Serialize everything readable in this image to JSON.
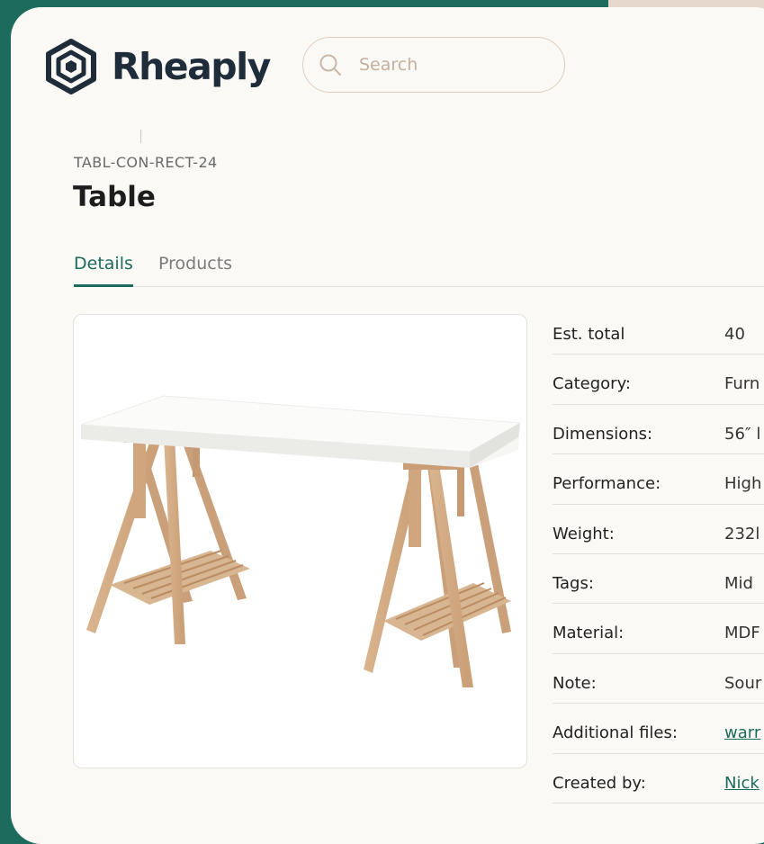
{
  "brand": {
    "name": "Rheaply",
    "color": "#1f2d3b",
    "accent": "#1c6b5c"
  },
  "search": {
    "placeholder": "Search",
    "value": ""
  },
  "item": {
    "sku": "TABL-CON-RECT-24",
    "title": "Table"
  },
  "tabs": [
    {
      "label": "Details",
      "active": true
    },
    {
      "label": "Products",
      "active": false
    }
  ],
  "details": [
    {
      "label": "Est. total",
      "value": "40",
      "link": false
    },
    {
      "label": "Category:",
      "value": "Furn",
      "link": false
    },
    {
      "label": "Dimensions:",
      "value": "56″ l",
      "link": false
    },
    {
      "label": "Performance:",
      "value": "High",
      "link": false
    },
    {
      "label": "Weight:",
      "value": "232l",
      "link": false
    },
    {
      "label": "Tags:",
      "value": "Mid",
      "link": false
    },
    {
      "label": "Material:",
      "value": "MDF",
      "link": false
    },
    {
      "label": "Note:",
      "value": "Sour",
      "link": false
    },
    {
      "label": "Additional files:",
      "value": "warr",
      "link": true
    },
    {
      "label": "Created by:",
      "value": "Nick",
      "link": true
    }
  ],
  "icons": {
    "logo": "hexagon-logo-icon",
    "search": "search-icon",
    "image": "table-product-image"
  }
}
